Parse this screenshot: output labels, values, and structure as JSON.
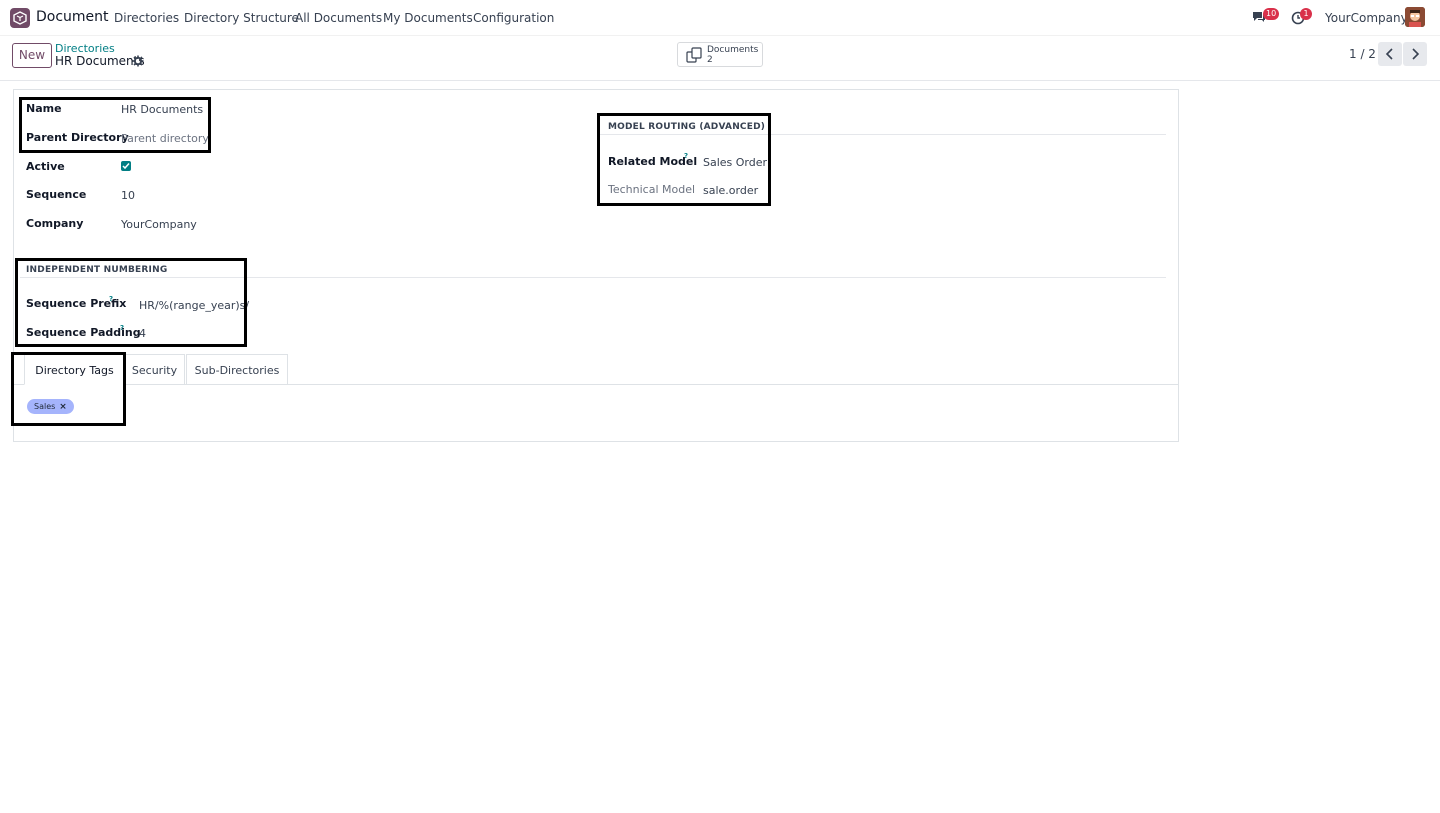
{
  "navbar": {
    "app_name": "Document",
    "menu": [
      "Directories",
      "Directory Structure",
      "All Documents",
      "My Documents",
      "Configuration"
    ],
    "messages_count": "10",
    "activities_count": "1",
    "company": "YourCompany"
  },
  "control_panel": {
    "new_label": "New",
    "breadcrumb_parent": "Directories",
    "breadcrumb_current": "HR Documents",
    "smart_button": {
      "label": "Documents",
      "value": "2"
    },
    "pager": "1 / 2"
  },
  "form": {
    "name_label": "Name",
    "name_value": "HR Documents",
    "parent_label": "Parent Directory",
    "parent_placeholder": "Parent directory",
    "active_label": "Active",
    "active_checked": true,
    "sequence_label": "Sequence",
    "sequence_value": "10",
    "company_label": "Company",
    "company_value": "YourCompany",
    "model_routing": {
      "title": "MODEL ROUTING (ADVANCED)",
      "related_model_label": "Related Model",
      "related_model_value": "Sales Order",
      "technical_model_label": "Technical Model",
      "technical_model_value": "sale.order"
    },
    "numbering": {
      "title": "INDEPENDENT NUMBERING",
      "prefix_label": "Sequence Prefix",
      "prefix_value": "HR/%(range_year)s/",
      "padding_label": "Sequence Padding",
      "padding_value": "4"
    },
    "help_mark": "?"
  },
  "tabs": [
    {
      "label": "Directory Tags",
      "active": true
    },
    {
      "label": "Security",
      "active": false
    },
    {
      "label": "Sub-Directories",
      "active": false
    }
  ],
  "tags": [
    {
      "label": "Sales",
      "color": "#a5b4fc"
    }
  ],
  "tag_remove": "×",
  "colors": {
    "brand": "#714b67",
    "accent": "#017e84",
    "badge": "#d9304a"
  }
}
